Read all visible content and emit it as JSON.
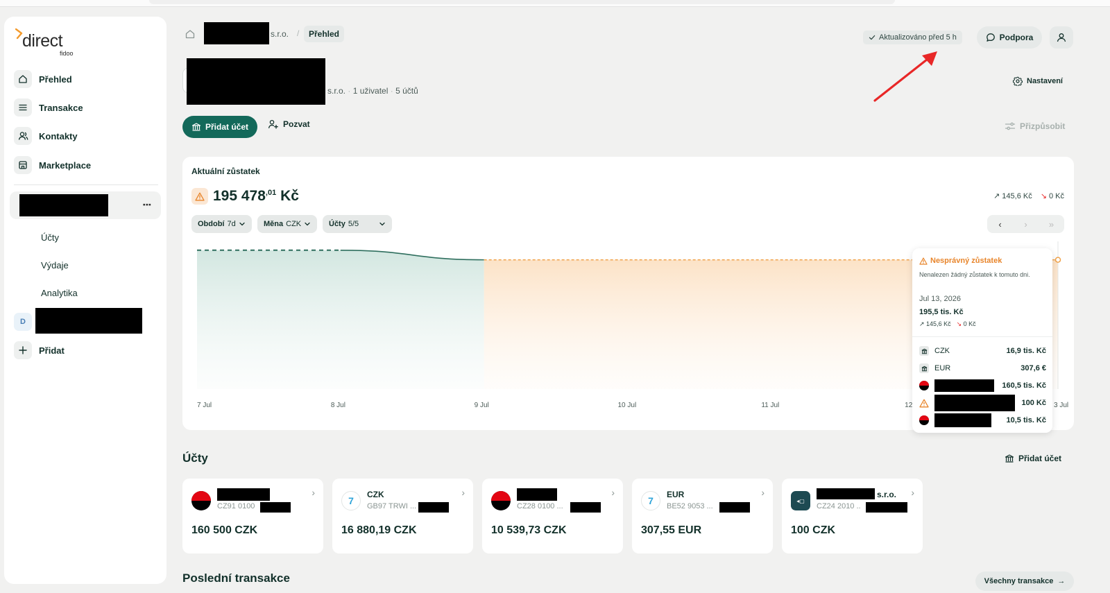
{
  "brand": {
    "name": "direct",
    "sub": "fidoo"
  },
  "sidebar": {
    "items": [
      {
        "label": "Přehled"
      },
      {
        "label": "Transakce"
      },
      {
        "label": "Kontakty"
      },
      {
        "label": "Marketplace"
      }
    ],
    "sub_items": [
      {
        "label": "Účty"
      },
      {
        "label": "Výdaje"
      },
      {
        "label": "Analytika"
      }
    ],
    "second_company_badge": "D",
    "add_label": "Přidat"
  },
  "header": {
    "breadcrumb_suffix": "s.r.o.",
    "breadcrumb_slash": "/",
    "breadcrumb_current": "Přehled",
    "updated": "Aktualizováno před 5 h",
    "support": "Podpora"
  },
  "company": {
    "suffix": "s.r.o.",
    "users": "1 uživatel",
    "accounts": "5 účtů",
    "settings": "Nastavení"
  },
  "actions": {
    "add_account": "Přidat účet",
    "invite": "Pozvat",
    "customize": "Přizpůsobit"
  },
  "balance": {
    "title": "Aktuální zůstatek",
    "amount_main": "195 478",
    "amount_dec": ",01",
    "currency": "Kč",
    "inflow": "145,6 Kč",
    "outflow": "0 Kč",
    "filters": {
      "period_label": "Období",
      "period_value": "7d",
      "currency_label": "Měna",
      "currency_value": "CZK",
      "accounts_label": "Účty",
      "accounts_value": "5/5"
    },
    "pager": {
      "prev": "‹",
      "next": "›",
      "last": "»"
    }
  },
  "chart_data": {
    "type": "area",
    "x": [
      "7 Jul",
      "8 Jul",
      "9 Jul",
      "10 Jul",
      "11 Jul",
      "12 Jul",
      "13 Jul"
    ],
    "x_labels": [
      "7 Jul",
      "8 Jul",
      "9 Jul",
      "10 Jul",
      "11 Jul",
      "12",
      "3 Jul"
    ],
    "series": [
      {
        "values": [
          210000,
          210000,
          195478,
          195478,
          195478,
          195478,
          195478
        ]
      }
    ],
    "dashed_segments": [
      "7 Jul–8 Jul",
      "9 Jul–13 Jul"
    ],
    "ylim": [
      0,
      215000
    ],
    "grid": false,
    "colors": {
      "solid": "#2f6f5e",
      "warning": "#f0a24a"
    }
  },
  "tooltip": {
    "title": "Nesprávný zůstatek",
    "desc": "Nenalezen žádný zůstatek k tomuto dni.",
    "date": "Jul 13, 2026",
    "value": "195,5 tis. Kč",
    "inflow": "145,6 Kč",
    "outflow": "0 Kč",
    "rows": [
      {
        "name": "CZK",
        "value": "16,9 tis. Kč",
        "icon": "bank-icon"
      },
      {
        "name": "EUR",
        "value": "307,6 €",
        "icon": "bank-icon"
      },
      {
        "name": "",
        "value": "160,5 tis. Kč",
        "icon": "kb-icon"
      },
      {
        "name": "",
        "value": "100 Kč",
        "icon": "warning-icon"
      },
      {
        "name": "",
        "value": "10,5 tis. Kč",
        "icon": "kb-icon"
      }
    ]
  },
  "accounts": {
    "title": "Účty",
    "add_label": "Přidat účet",
    "list": [
      {
        "name": "",
        "iban": "CZ91 0100",
        "balance": "160 500 CZK",
        "icon": "kb-icon"
      },
      {
        "name": "CZK",
        "iban": "GB97 TRWI ...",
        "balance": "16 880,19 CZK",
        "icon": "wise-icon"
      },
      {
        "name": "",
        "iban": "CZ28 0100 ...",
        "balance": "10 539,73 CZK",
        "icon": "kb-icon"
      },
      {
        "name": "EUR",
        "iban": "BE52 9053 ...",
        "balance": "307,55 EUR",
        "icon": "wise-icon"
      },
      {
        "name": "s.r.o.",
        "iban": "CZ24 2010 ..",
        "balance": "100 CZK",
        "icon": "fio-icon"
      }
    ]
  },
  "transactions": {
    "title": "Poslední transakce",
    "all_label": "Všechny transakce"
  }
}
